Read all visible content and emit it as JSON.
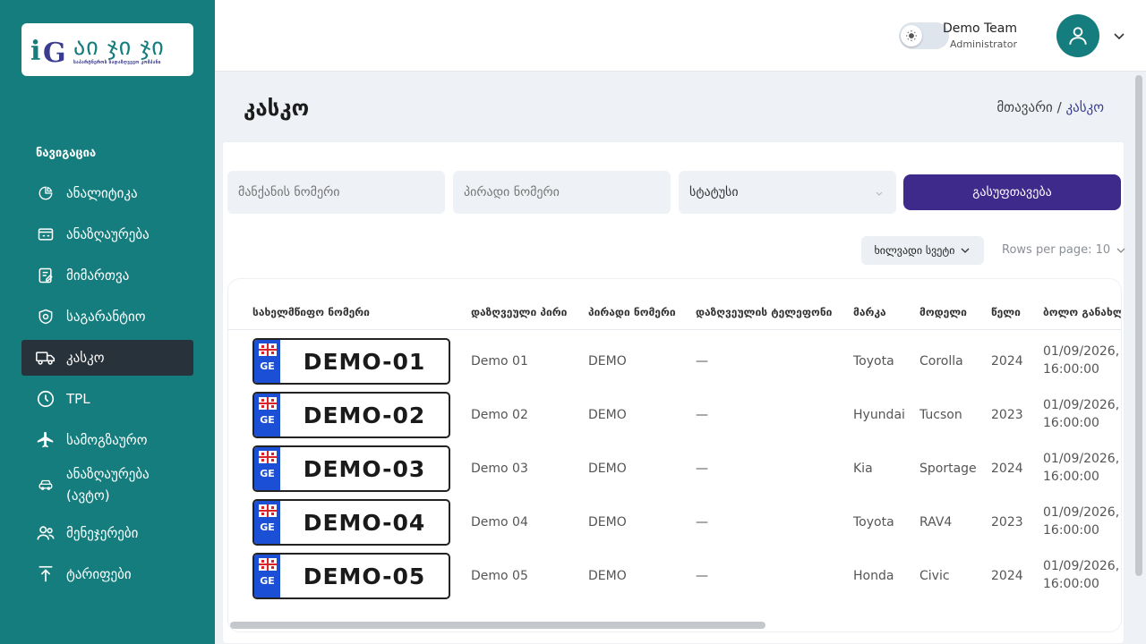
{
  "sidebar": {
    "logo": {
      "mark": "iG",
      "title": "აი ჯი ჯი",
      "subtitle": "საპარტნეროს სადაზღვევო კომპანი"
    },
    "heading": "ნავიგაცია",
    "items": [
      {
        "label": "ანალიტიკა",
        "icon": "pie-chart-icon"
      },
      {
        "label": "ანაზღაურება",
        "icon": "money-card-icon"
      },
      {
        "label": "მიმართვა",
        "icon": "edit-document-icon"
      },
      {
        "label": "საგარანტიო",
        "icon": "shield-icon"
      },
      {
        "label": "კასკო",
        "icon": "truck-icon",
        "active": true
      },
      {
        "label": "TPL",
        "icon": "clock-icon"
      },
      {
        "label": "სამოგზაურო",
        "icon": "airplane-icon"
      },
      {
        "label": "ანაზღაურება (ავტო)",
        "icon": "car-icon"
      },
      {
        "label": "მენეჯერები",
        "icon": "users-icon"
      },
      {
        "label": "ტარიფები",
        "icon": "upload-icon"
      }
    ]
  },
  "header": {
    "user_name": "Demo Team",
    "user_role": "Administrator"
  },
  "page": {
    "title": "კასკო",
    "breadcrumb_home": "მთავარი /",
    "breadcrumb_current": "კასკო"
  },
  "filters": {
    "car_number_placeholder": "მანქანის ნომერი",
    "personal_number_placeholder": "პირადი ნომერი",
    "status_placeholder": "სტატუსი",
    "reset_label": "გასუფთავება"
  },
  "table_controls": {
    "visible_columns_label": "ხილვადი სვეტი",
    "rows_per_page_label": "Rows per page: 10"
  },
  "table": {
    "columns": [
      "სახელმწიფო ნომერი",
      "დაზღვეული პირი",
      "პირადი ნომერი",
      "დაზღვეულის ტელეფონი",
      "მარკა",
      "მოდელი",
      "წელი",
      "ბოლო განახლ"
    ],
    "rows": [
      {
        "plate": "DEMO-01",
        "country": "GE",
        "insured": "Demo 01",
        "personal_no": "DEMO",
        "phone": "—",
        "make": "Toyota",
        "model": "Corolla",
        "year": "2024",
        "updated_date": "01/09/2026,",
        "updated_time": "16:00:00"
      },
      {
        "plate": "DEMO-02",
        "country": "GE",
        "insured": "Demo 02",
        "personal_no": "DEMO",
        "phone": "—",
        "make": "Hyundai",
        "model": "Tucson",
        "year": "2023",
        "updated_date": "01/09/2026,",
        "updated_time": "16:00:00"
      },
      {
        "plate": "DEMO-03",
        "country": "GE",
        "insured": "Demo 03",
        "personal_no": "DEMO",
        "phone": "—",
        "make": "Kia",
        "model": "Sportage",
        "year": "2024",
        "updated_date": "01/09/2026,",
        "updated_time": "16:00:00"
      },
      {
        "plate": "DEMO-04",
        "country": "GE",
        "insured": "Demo 04",
        "personal_no": "DEMO",
        "phone": "—",
        "make": "Toyota",
        "model": "RAV4",
        "year": "2023",
        "updated_date": "01/09/2026,",
        "updated_time": "16:00:00"
      },
      {
        "plate": "DEMO-05",
        "country": "GE",
        "insured": "Demo 05",
        "personal_no": "DEMO",
        "phone": "—",
        "make": "Honda",
        "model": "Civic",
        "year": "2024",
        "updated_date": "01/09/2026,",
        "updated_time": "16:00:00"
      }
    ]
  },
  "colors": {
    "sidebar": "#157d7d",
    "active_nav": "#27323a",
    "primary_button": "#3d2a8a",
    "plate_band": "#1a4fd6"
  }
}
